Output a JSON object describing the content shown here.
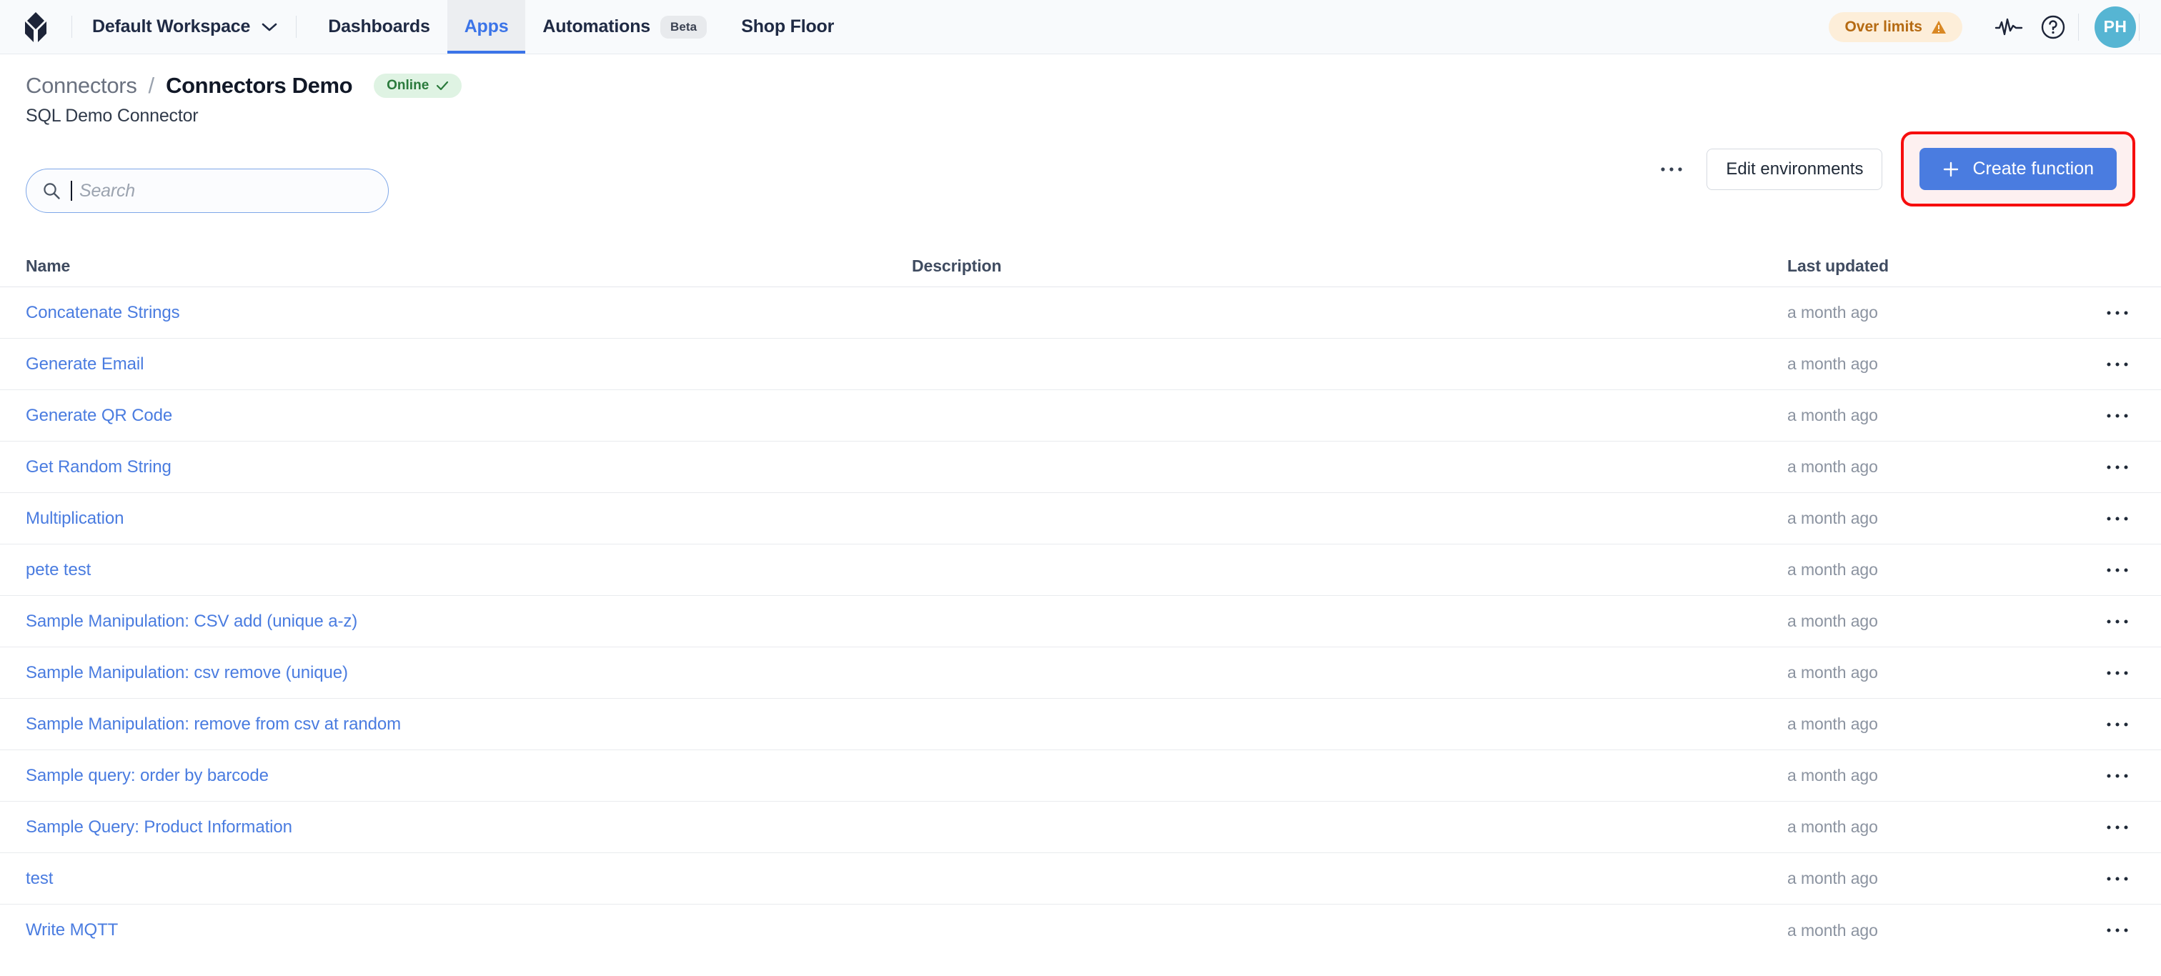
{
  "topbar": {
    "logo_icon": "brand-logo-icon",
    "workspace": {
      "label": "Default Workspace",
      "chevron_icon": "chevron-down-icon"
    },
    "tabs": [
      {
        "label": "Dashboards",
        "active": false,
        "badge": ""
      },
      {
        "label": "Apps",
        "active": true,
        "badge": ""
      },
      {
        "label": "Automations",
        "active": false,
        "badge": "Beta"
      },
      {
        "label": "Shop Floor",
        "active": false,
        "badge": ""
      }
    ],
    "over_limits": {
      "label": "Over limits",
      "icon": "warning-triangle-icon",
      "color": "#b56a12",
      "bg": "#fdeed9"
    },
    "activity_icon": "pulse-activity-icon",
    "help_icon": "help-circle-icon",
    "avatar": {
      "initials": "PH",
      "color": "#56b5d3"
    }
  },
  "header": {
    "breadcrumb_parent": "Connectors",
    "breadcrumb_separator": "/",
    "breadcrumb_current": "Connectors Demo",
    "status_badge": {
      "label": "Online",
      "icon": "check-icon",
      "color": "#2a7a3c",
      "bg": "#dff3e3"
    },
    "subtitle": "SQL Demo Connector",
    "more_icon": "ellipsis-icon",
    "edit_environments_label": "Edit environments",
    "create_function_label": "Create function",
    "create_function_icon": "plus-icon",
    "highlight_color": "#f60d0d"
  },
  "search": {
    "icon": "search-icon",
    "placeholder": "Search",
    "value": ""
  },
  "table": {
    "columns": [
      "Name",
      "Description",
      "Last updated"
    ],
    "row_menu_icon": "ellipsis-icon",
    "rows": [
      {
        "name": "Concatenate Strings",
        "description": "",
        "last_updated": "a month ago"
      },
      {
        "name": "Generate Email",
        "description": "",
        "last_updated": "a month ago"
      },
      {
        "name": "Generate QR Code",
        "description": "",
        "last_updated": "a month ago"
      },
      {
        "name": "Get Random String",
        "description": "",
        "last_updated": "a month ago"
      },
      {
        "name": "Multiplication",
        "description": "",
        "last_updated": "a month ago"
      },
      {
        "name": "pete test",
        "description": "",
        "last_updated": "a month ago"
      },
      {
        "name": "Sample Manipulation: CSV add (unique a-z)",
        "description": "",
        "last_updated": "a month ago"
      },
      {
        "name": "Sample Manipulation: csv remove (unique)",
        "description": "",
        "last_updated": "a month ago"
      },
      {
        "name": "Sample Manipulation: remove from csv at random",
        "description": "",
        "last_updated": "a month ago"
      },
      {
        "name": "Sample query: order by barcode",
        "description": "",
        "last_updated": "a month ago"
      },
      {
        "name": "Sample Query: Product Information",
        "description": "",
        "last_updated": "a month ago"
      },
      {
        "name": "test",
        "description": "",
        "last_updated": "a month ago"
      },
      {
        "name": "Write MQTT",
        "description": "",
        "last_updated": "a month ago"
      }
    ]
  }
}
